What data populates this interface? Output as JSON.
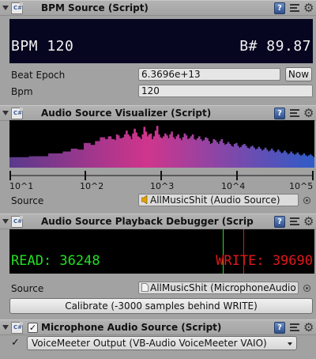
{
  "components": {
    "bpm_source": {
      "title": "BPM Source (Script)",
      "display": {
        "bpm_text": "BPM 120",
        "beat_text": "B# 89.87"
      },
      "fields": [
        {
          "label": "Beat Epoch",
          "value": "6.3696e+13"
        },
        {
          "label": "Bpm",
          "value": "120"
        }
      ],
      "now_button": "Now"
    },
    "audio_visualizer": {
      "title": "Audio Source Visualizer (Script)",
      "axis_ticks": [
        "10^1",
        "10^2",
        "10^3",
        "10^4",
        "10^5"
      ],
      "source_label": "Source",
      "source_value": "AllMusicShit (Audio Source)"
    },
    "playback_debugger": {
      "title": "Audio Source Playback Debugger (Scrip",
      "read_text": "READ: 36248",
      "write_text": "WRITE: 39690",
      "source_label": "Source",
      "source_value": "AllMusicShit (MicrophoneAudio",
      "calibrate_button": "Calibrate (-3000 samples behind WRITE)"
    },
    "microphone_source": {
      "title": "Microphone Audio Source (Script)",
      "enabled_mark": "✓",
      "device_selected": "VoiceMeeter Output (VB-Audio VoiceMeeter VAIO)"
    }
  },
  "icons": {
    "script": "script-icon",
    "help": "help-icon",
    "preset": "preset-icon",
    "gear": "gear-icon",
    "speaker": "speaker-icon",
    "mic_asset": "microphone-asset-icon",
    "object_picker": "object-picker-icon"
  },
  "colors": {
    "inspector_bg": "#a2a2a2",
    "bpm_panel_bg": "#060620",
    "read_color": "#22e022",
    "write_color": "#e01818",
    "spectrum_low": "#5a3a8c",
    "spectrum_mid": "#d0358c",
    "spectrum_high": "#2f5cc8"
  },
  "spectrum": [
    0.22,
    0.22,
    0.22,
    0.22,
    0.22,
    0.22,
    0.22,
    0.22,
    0.22,
    0.22,
    0.22,
    0.22,
    0.24,
    0.24,
    0.24,
    0.24,
    0.24,
    0.24,
    0.24,
    0.24,
    0.24,
    0.24,
    0.24,
    0.24,
    0.3,
    0.3,
    0.3,
    0.3,
    0.3,
    0.3,
    0.3,
    0.3,
    0.3,
    0.34,
    0.34,
    0.34,
    0.34,
    0.34,
    0.4,
    0.4,
    0.4,
    0.4,
    0.38,
    0.38,
    0.38,
    0.38,
    0.52,
    0.52,
    0.52,
    0.52,
    0.48,
    0.48,
    0.48,
    0.56,
    0.56,
    0.56,
    0.64,
    0.64,
    0.64,
    0.6,
    0.6,
    0.66,
    0.66,
    0.6,
    0.6,
    0.58,
    0.7,
    0.68,
    0.62,
    0.62,
    0.64,
    0.7,
    0.78,
    0.7,
    0.66,
    0.6,
    0.72,
    0.82,
    0.74,
    0.66,
    0.64,
    0.6,
    0.7,
    0.86,
    0.76,
    0.66,
    0.7,
    0.72,
    0.6,
    0.66,
    0.78,
    0.88,
    0.7,
    0.64,
    0.62,
    0.66,
    0.72,
    0.68,
    0.62,
    0.7,
    0.76,
    0.64,
    0.6,
    0.66,
    0.7,
    0.62,
    0.58,
    0.64,
    0.72,
    0.68,
    0.6,
    0.62,
    0.66,
    0.7,
    0.6,
    0.58,
    0.62,
    0.66,
    0.6,
    0.56,
    0.58,
    0.64,
    0.62,
    0.56,
    0.5,
    0.52,
    0.6,
    0.58,
    0.54,
    0.5,
    0.56,
    0.6,
    0.52,
    0.48,
    0.5,
    0.54,
    0.5,
    0.46,
    0.44,
    0.5,
    0.52,
    0.46,
    0.42,
    0.44,
    0.48,
    0.5,
    0.46,
    0.42,
    0.4,
    0.44,
    0.46,
    0.42,
    0.38,
    0.4,
    0.44,
    0.4,
    0.36,
    0.38,
    0.42,
    0.38,
    0.34,
    0.36,
    0.4,
    0.36,
    0.32,
    0.34,
    0.38,
    0.34,
    0.3,
    0.32,
    0.36,
    0.32,
    0.28,
    0.3,
    0.34,
    0.3,
    0.27,
    0.29,
    0.32,
    0.28,
    0.25,
    0.27,
    0.3,
    0.26,
    0.24,
    0.26,
    0.28,
    0.25,
    0.22
  ]
}
